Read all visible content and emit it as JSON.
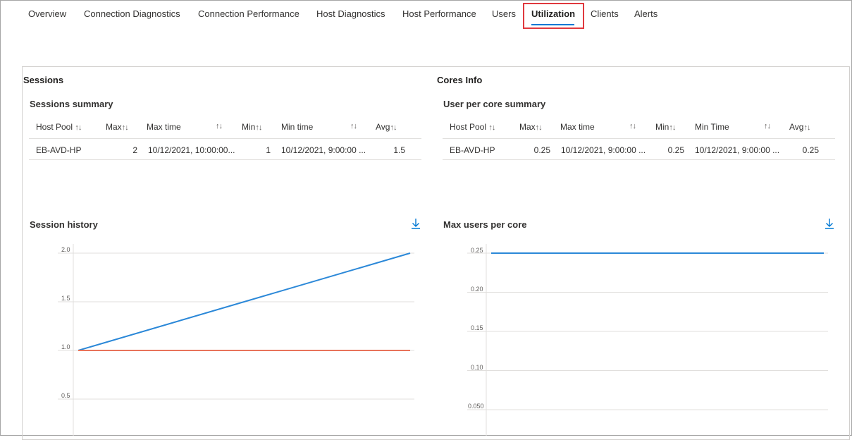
{
  "tabs": [
    {
      "label": "Overview"
    },
    {
      "label": "Connection Diagnostics"
    },
    {
      "label": "Connection Performance"
    },
    {
      "label": "Host Diagnostics"
    },
    {
      "label": "Host Performance"
    },
    {
      "label": "Users"
    },
    {
      "label": "Utilization",
      "active": true
    },
    {
      "label": "Clients"
    },
    {
      "label": "Alerts"
    }
  ],
  "sessions": {
    "title": "Sessions",
    "summary_title": "Sessions summary",
    "columns": [
      "Host Pool",
      "Max",
      "Max time",
      "Min",
      "Min time",
      "Avg"
    ],
    "sort_glyph": "↑↓",
    "rows": [
      {
        "host_pool": "EB-AVD-HP",
        "max": "2",
        "max_time": "10/12/2021, 10:00:00...",
        "min": "1",
        "min_time": "10/12/2021, 9:00:00 ...",
        "avg": "1.5"
      }
    ],
    "history_title": "Session history"
  },
  "cores": {
    "title": "Cores Info",
    "summary_title": "User per core summary",
    "columns": [
      "Host Pool",
      "Max",
      "Max time",
      "Min",
      "Min Time",
      "Avg"
    ],
    "sort_glyph": "↑↓",
    "rows": [
      {
        "host_pool": "EB-AVD-HP",
        "max": "0.25",
        "max_time": "10/12/2021, 9:00:00 ...",
        "min": "0.25",
        "min_time": "10/12/2021, 9:00:00 ...",
        "avg": "0.25"
      }
    ],
    "chart_title": "Max users per core"
  },
  "icons": {
    "download": "download-arrow-icon"
  },
  "colors": {
    "accent": "#0078d4",
    "max_series": "#2b88d8",
    "min_series": "#e8735a",
    "highlight": "#e0393e"
  },
  "chart_data": [
    {
      "type": "line",
      "title": "Session history",
      "y_ticks": [
        "2.0",
        "1.5",
        "1.0",
        "0.5"
      ],
      "ylim_visible": [
        0.35,
        2.0
      ],
      "series": [
        {
          "values": [
            1.0,
            2.0
          ],
          "color": "#2b88d8"
        },
        {
          "values": [
            1.0,
            1.0
          ],
          "color": "#e8735a"
        }
      ]
    },
    {
      "type": "line",
      "title": "Max users per core",
      "y_ticks": [
        "0.25",
        "0.20",
        "0.15",
        "0.10",
        "0.050"
      ],
      "ylim_visible": [
        0.035,
        0.25
      ],
      "series": [
        {
          "values": [
            0.25,
            0.25
          ],
          "color": "#2b88d8"
        }
      ]
    }
  ]
}
